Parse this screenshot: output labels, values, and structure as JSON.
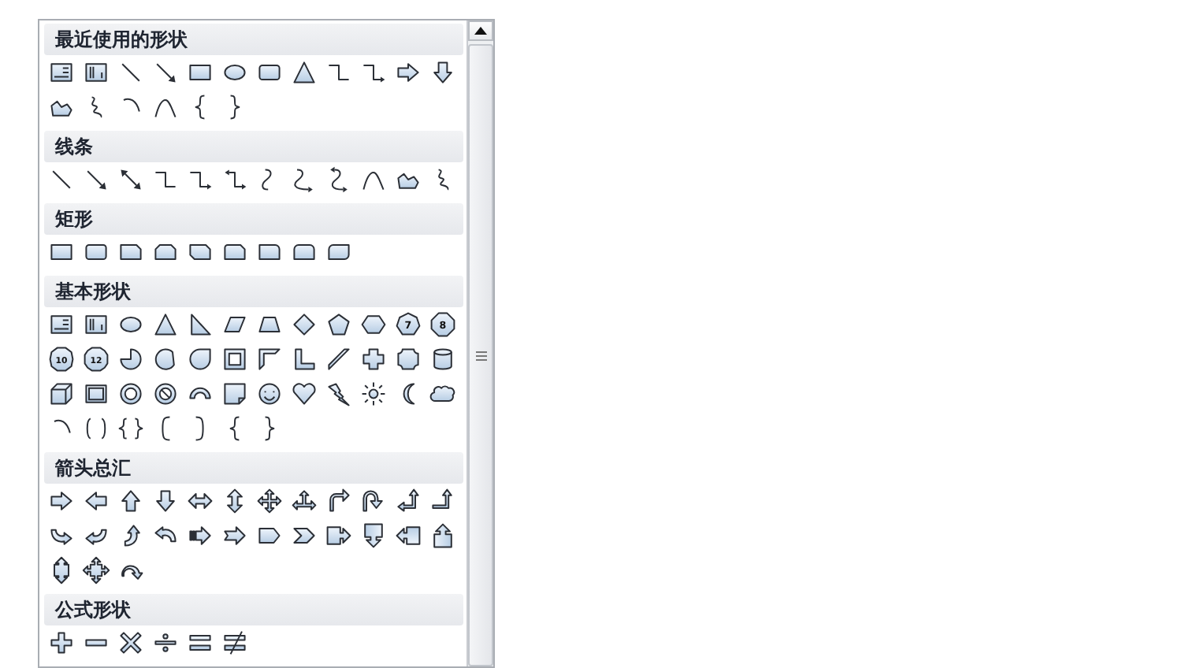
{
  "sections": [
    {
      "title": "最近使用的形状",
      "shapes": [
        {
          "kind": "textbox"
        },
        {
          "kind": "vertical-textbox"
        },
        {
          "kind": "line"
        },
        {
          "kind": "arrow-line"
        },
        {
          "kind": "rectangle"
        },
        {
          "kind": "oval"
        },
        {
          "kind": "rounded-rectangle"
        },
        {
          "kind": "triangle"
        },
        {
          "kind": "elbow-connector"
        },
        {
          "kind": "elbow-arrow-connector"
        },
        {
          "kind": "right-arrow"
        },
        {
          "kind": "down-arrow"
        },
        {
          "kind": "freeform"
        },
        {
          "kind": "scribble"
        },
        {
          "kind": "arc"
        },
        {
          "kind": "curve"
        },
        {
          "kind": "left-brace"
        },
        {
          "kind": "right-brace"
        }
      ]
    },
    {
      "title": "线条",
      "shapes": [
        {
          "kind": "line"
        },
        {
          "kind": "arrow-line"
        },
        {
          "kind": "double-arrow-line"
        },
        {
          "kind": "elbow-connector"
        },
        {
          "kind": "elbow-arrow-connector"
        },
        {
          "kind": "elbow-double-arrow-connector"
        },
        {
          "kind": "curved-connector"
        },
        {
          "kind": "curved-arrow-connector"
        },
        {
          "kind": "curved-double-arrow-connector"
        },
        {
          "kind": "curve"
        },
        {
          "kind": "freeform"
        },
        {
          "kind": "scribble"
        }
      ]
    },
    {
      "title": "矩形",
      "shapes": [
        {
          "kind": "rectangle"
        },
        {
          "kind": "rounded-rectangle"
        },
        {
          "kind": "snip-corner-rectangle"
        },
        {
          "kind": "snip-same-side-rectangle"
        },
        {
          "kind": "snip-diagonal-rectangle"
        },
        {
          "kind": "snip-round-rectangle"
        },
        {
          "kind": "round-corner-rectangle"
        },
        {
          "kind": "round-same-side-rectangle"
        },
        {
          "kind": "round-diagonal-rectangle"
        }
      ]
    },
    {
      "title": "基本形状",
      "shapes": [
        {
          "kind": "textbox"
        },
        {
          "kind": "vertical-textbox"
        },
        {
          "kind": "oval"
        },
        {
          "kind": "triangle"
        },
        {
          "kind": "right-triangle"
        },
        {
          "kind": "parallelogram"
        },
        {
          "kind": "trapezoid"
        },
        {
          "kind": "diamond"
        },
        {
          "kind": "pentagon"
        },
        {
          "kind": "hexagon"
        },
        {
          "kind": "heptagon",
          "label": "7"
        },
        {
          "kind": "octagon",
          "label": "8"
        },
        {
          "kind": "decagon",
          "label": "10"
        },
        {
          "kind": "dodecagon",
          "label": "12"
        },
        {
          "kind": "pie"
        },
        {
          "kind": "chord"
        },
        {
          "kind": "teardrop"
        },
        {
          "kind": "frame"
        },
        {
          "kind": "half-frame"
        },
        {
          "kind": "l-shape"
        },
        {
          "kind": "diagonal-stripe"
        },
        {
          "kind": "cross"
        },
        {
          "kind": "plaque"
        },
        {
          "kind": "can"
        },
        {
          "kind": "cube"
        },
        {
          "kind": "bevel"
        },
        {
          "kind": "donut"
        },
        {
          "kind": "no-symbol"
        },
        {
          "kind": "block-arc"
        },
        {
          "kind": "folded-corner"
        },
        {
          "kind": "smiley"
        },
        {
          "kind": "heart"
        },
        {
          "kind": "lightning"
        },
        {
          "kind": "sun"
        },
        {
          "kind": "moon"
        },
        {
          "kind": "cloud"
        },
        {
          "kind": "arc"
        },
        {
          "kind": "double-bracket"
        },
        {
          "kind": "double-brace"
        },
        {
          "kind": "left-bracket"
        },
        {
          "kind": "right-bracket"
        },
        {
          "kind": "left-brace"
        },
        {
          "kind": "right-brace"
        }
      ]
    },
    {
      "title": "箭头总汇",
      "shapes": [
        {
          "kind": "right-arrow"
        },
        {
          "kind": "left-arrow"
        },
        {
          "kind": "up-arrow"
        },
        {
          "kind": "down-arrow"
        },
        {
          "kind": "left-right-arrow"
        },
        {
          "kind": "up-down-arrow"
        },
        {
          "kind": "quad-arrow"
        },
        {
          "kind": "left-right-up-arrow"
        },
        {
          "kind": "bent-arrow"
        },
        {
          "kind": "u-turn-arrow"
        },
        {
          "kind": "left-up-arrow"
        },
        {
          "kind": "bent-up-arrow"
        },
        {
          "kind": "curved-right-arrow"
        },
        {
          "kind": "curved-left-arrow"
        },
        {
          "kind": "curved-up-arrow"
        },
        {
          "kind": "curved-down-arrow"
        },
        {
          "kind": "striped-right-arrow"
        },
        {
          "kind": "notched-right-arrow"
        },
        {
          "kind": "pentagon-arrow"
        },
        {
          "kind": "chevron"
        },
        {
          "kind": "right-arrow-callout"
        },
        {
          "kind": "down-arrow-callout"
        },
        {
          "kind": "left-arrow-callout"
        },
        {
          "kind": "up-arrow-callout"
        },
        {
          "kind": "up-down-arrow-callout"
        },
        {
          "kind": "quad-arrow-callout"
        },
        {
          "kind": "circular-arrow"
        }
      ]
    },
    {
      "title": "公式形状",
      "shapes": [
        {
          "kind": "plus"
        },
        {
          "kind": "minus"
        },
        {
          "kind": "multiply"
        },
        {
          "kind": "divide"
        },
        {
          "kind": "equal"
        },
        {
          "kind": "not-equal"
        }
      ]
    }
  ]
}
